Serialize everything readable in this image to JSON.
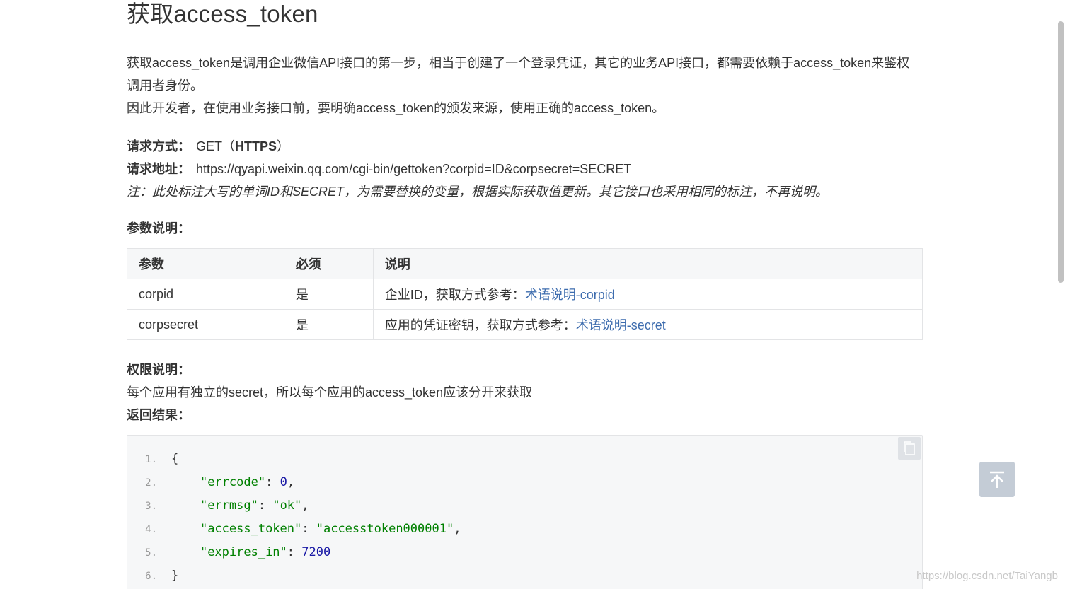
{
  "title": "获取access_token",
  "intro": {
    "line1": "获取access_token是调用企业微信API接口的第一步，相当于创建了一个登录凭证，其它的业务API接口，都需要依赖于access_token来鉴权调用者身份。",
    "line2": "因此开发者，在使用业务接口前，要明确access_token的颁发来源，使用正确的access_token。"
  },
  "request": {
    "method_label": "请求方式：",
    "method_value": "GET（",
    "method_bold": "HTTPS",
    "method_close": "）",
    "url_label": "请求地址：",
    "url_value": "https://qyapi.weixin.qq.com/cgi-bin/gettoken?corpid=ID&corpsecret=SECRET",
    "note": "注：此处标注大写的单词ID和SECRET，为需要替换的变量，根据实际获取值更新。其它接口也采用相同的标注，不再说明。"
  },
  "params": {
    "label": "参数说明：",
    "headers": [
      "参数",
      "必须",
      "说明"
    ],
    "rows": [
      {
        "name": "corpid",
        "required": "是",
        "desc": "企业ID，获取方式参考：",
        "link": "术语说明-corpid"
      },
      {
        "name": "corpsecret",
        "required": "是",
        "desc": "应用的凭证密钥，获取方式参考：",
        "link": "术语说明-secret"
      }
    ]
  },
  "permission": {
    "label": "权限说明：",
    "text": "每个应用有独立的secret，所以每个应用的access_token应该分开来获取"
  },
  "result": {
    "label": "返回结果：",
    "line_numbers": [
      "1.",
      "2.",
      "3.",
      "4.",
      "5.",
      "6."
    ],
    "keys": [
      "\"errcode\"",
      "\"errmsg\"",
      "\"access_token\"",
      "\"expires_in\""
    ],
    "values": [
      "0",
      "\"ok\"",
      "\"accesstoken000001\"",
      "7200"
    ],
    "open_brace": "{",
    "close_brace": "}"
  },
  "watermark": "https://blog.csdn.net/TaiYangb",
  "colors": {
    "link": "#3d6cae",
    "string": "#008000",
    "number": "#1a1aa6",
    "code_bg": "#f6f7f8"
  }
}
